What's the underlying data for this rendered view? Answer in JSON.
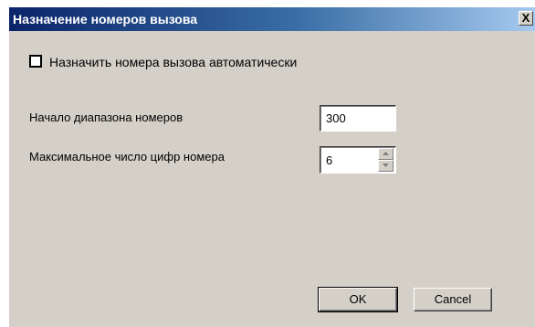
{
  "window": {
    "title": "Назначение номеров вызова",
    "close_label": "X"
  },
  "auto_assign": {
    "label": "Назначить номера вызова автоматически",
    "checked": false
  },
  "range_start": {
    "label": "Начало диапазона номеров",
    "value": "300"
  },
  "max_digits": {
    "label": "Максимальное число цифр номера",
    "value": "6"
  },
  "buttons": {
    "ok_label": "OK",
    "cancel_label": "Cancel"
  }
}
